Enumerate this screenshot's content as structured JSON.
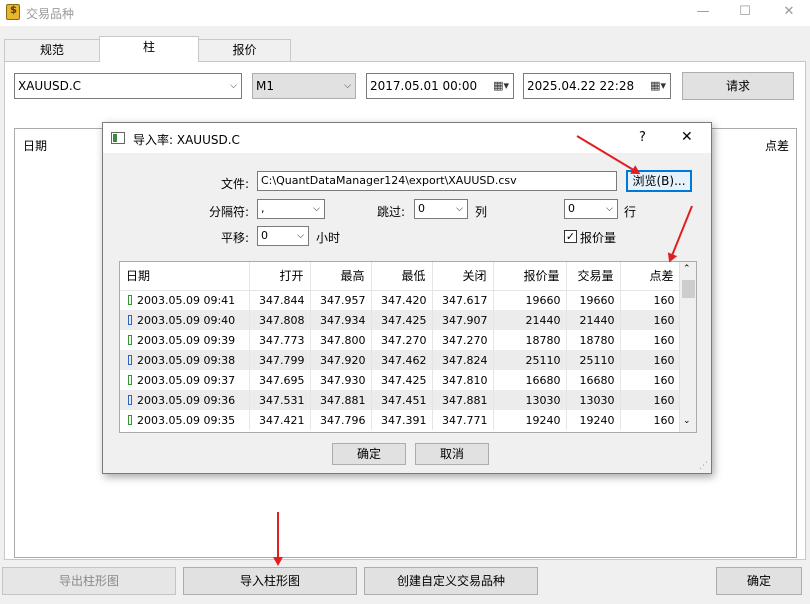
{
  "window": {
    "title": "交易品种",
    "minimize": "—",
    "maximize": "☐",
    "close": "✕"
  },
  "tabs": [
    {
      "label": "规范"
    },
    {
      "label": "柱"
    },
    {
      "label": "报价"
    }
  ],
  "toolbar": {
    "symbol": "XAUUSD.C",
    "timeframe": "M1",
    "from_date": "2017.05.01 00:00",
    "to_date": "2025.04.22 22:28",
    "request_label": "请求"
  },
  "list_header": {
    "date": "日期",
    "spread": "点差"
  },
  "dialog": {
    "title": "导入率: XAUUSD.C",
    "help": "?",
    "close": "✕",
    "file_label": "文件:",
    "file_value": "C:\\QuantDataManager124\\export\\XAUUSD.csv",
    "browse_label": "浏览(B)...",
    "separator_label": "分隔符:",
    "separator_value": ",",
    "skip_label": "跳过:",
    "skip_value": "0",
    "column_label": "列",
    "row_value": "0",
    "row_label": "行",
    "shift_label": "平移:",
    "shift_value": "0",
    "hours_label": "小时",
    "ticks_label": "报价量",
    "ticks_checked": true,
    "ok_label": "确定",
    "cancel_label": "取消",
    "columns": [
      "日期",
      "打开",
      "最高",
      "最低",
      "关闭",
      "报价量",
      "交易量",
      "点差"
    ],
    "rows": [
      {
        "candle": "green",
        "date": "2003.05.09 09:41",
        "open": "347.844",
        "high": "347.957",
        "low": "347.420",
        "close": "347.617",
        "ticks": "19660",
        "volume": "19660",
        "spread": "160"
      },
      {
        "candle": "blue",
        "date": "2003.05.09 09:40",
        "open": "347.808",
        "high": "347.934",
        "low": "347.425",
        "close": "347.907",
        "ticks": "21440",
        "volume": "21440",
        "spread": "160"
      },
      {
        "candle": "green",
        "date": "2003.05.09 09:39",
        "open": "347.773",
        "high": "347.800",
        "low": "347.270",
        "close": "347.270",
        "ticks": "18780",
        "volume": "18780",
        "spread": "160"
      },
      {
        "candle": "blue",
        "date": "2003.05.09 09:38",
        "open": "347.799",
        "high": "347.920",
        "low": "347.462",
        "close": "347.824",
        "ticks": "25110",
        "volume": "25110",
        "spread": "160"
      },
      {
        "candle": "green",
        "date": "2003.05.09 09:37",
        "open": "347.695",
        "high": "347.930",
        "low": "347.425",
        "close": "347.810",
        "ticks": "16680",
        "volume": "16680",
        "spread": "160"
      },
      {
        "candle": "blue",
        "date": "2003.05.09 09:36",
        "open": "347.531",
        "high": "347.881",
        "low": "347.451",
        "close": "347.881",
        "ticks": "13030",
        "volume": "13030",
        "spread": "160"
      },
      {
        "candle": "green",
        "date": "2003.05.09 09:35",
        "open": "347.421",
        "high": "347.796",
        "low": "347.391",
        "close": "347.771",
        "ticks": "19240",
        "volume": "19240",
        "spread": "160"
      }
    ]
  },
  "footer": {
    "export_label": "导出柱形图",
    "import_label": "导入柱形图",
    "create_label": "创建自定义交易品种",
    "ok_label": "确定"
  },
  "colors": {
    "annotation_arrow": "#e02020",
    "candle_up": "#2a9a2a",
    "candle_down": "#2a62c9"
  }
}
